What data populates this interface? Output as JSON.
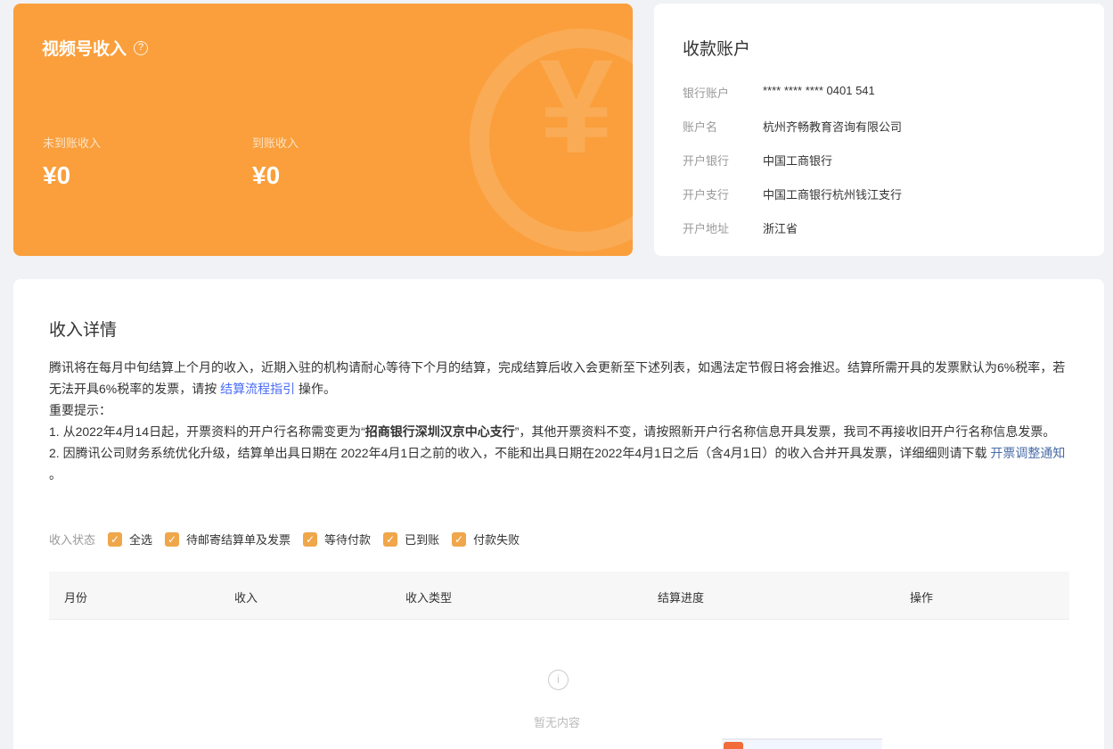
{
  "income": {
    "title": "视频号收入",
    "help_glyph": "?",
    "pending_label": "未到账收入",
    "pending_value": "¥0",
    "received_label": "到账收入",
    "received_value": "¥0",
    "bg_glyph": "¥"
  },
  "account": {
    "title": "收款账户",
    "rows": [
      {
        "key": "银行账户",
        "value": "**** **** **** 0401 541"
      },
      {
        "key": "账户名",
        "value": "杭州齐畅教育咨询有限公司"
      },
      {
        "key": "开户银行",
        "value": "中国工商银行"
      },
      {
        "key": "开户支行",
        "value": "中国工商银行杭州钱江支行"
      },
      {
        "key": "开户地址",
        "value": "浙江省"
      }
    ]
  },
  "detail": {
    "title": "收入详情",
    "p1_a": "腾讯将在每月中旬结算上个月的收入，近期入驻的机构请耐心等待下个月的结算，完成结算后收入会更新至下述列表，如遇法定节假日将会推迟。结算所需开具的发票默认为6%税率，若无法开具6%税率的发票，请按 ",
    "p1_link": "结算流程指引",
    "p1_b": " 操作。",
    "p2": "重要提示：",
    "p3_a": "1. 从2022年4月14日起，开票资料的开户行名称需变更为“",
    "p3_bold": "招商银行深圳汉京中心支行",
    "p3_b": "”，其他开票资料不变，请按照新开户行名称信息开具发票，我司不再接收旧开户行名称信息发票。",
    "p4_a": "2. 因腾讯公司财务系统优化升级，结算单出具日期在 2022年4月1日之前的收入，不能和出具日期在2022年4月1日之后（含4月1日）的收入合并开具发票，详细细则请下载 ",
    "p4_link": "开票调整通知",
    "p4_b": " 。"
  },
  "filter": {
    "label": "收入状态",
    "check_glyph": "✓",
    "options": [
      "全选",
      "待邮寄结算单及发票",
      "等待付款",
      "已到账",
      "付款失败"
    ]
  },
  "table": {
    "columns": [
      "月份",
      "收入",
      "收入类型",
      "结算进度",
      "操作"
    ],
    "empty_icon": "i",
    "empty_text": "暂无内容"
  }
}
